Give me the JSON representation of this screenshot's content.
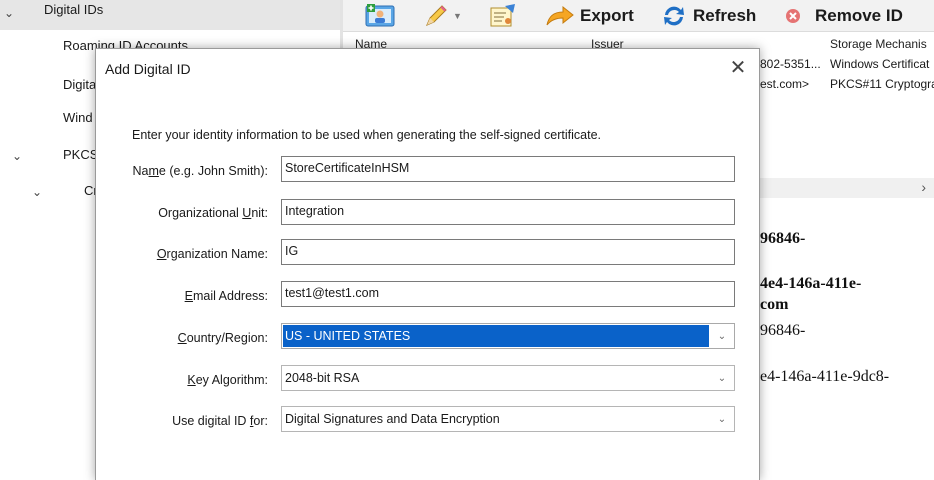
{
  "tree": {
    "items": [
      {
        "label": "Digital IDs",
        "chevron": "⌄"
      },
      {
        "label": "Roaming ID Accounts"
      },
      {
        "label": "Digita"
      },
      {
        "label": "Wind"
      },
      {
        "label": "PKCS",
        "chevron": "⌄"
      },
      {
        "label": "Cr",
        "chevron": "⌄"
      }
    ]
  },
  "toolbar": {
    "export_label": "Export",
    "refresh_label": "Refresh",
    "remove_label": "Remove ID"
  },
  "list": {
    "headers": [
      "Name",
      "Issuer",
      "Storage Mechanis"
    ],
    "rows": [
      [
        "802-5351...",
        "Windows Certificat"
      ],
      [
        "est.com>",
        "PKCS#11 Cryptogra"
      ]
    ]
  },
  "scroll_arrow": "›",
  "details": {
    "line1": "96846-",
    "line2": "4e4-146a-411e-",
    "line3": "com",
    "line4": "96846-",
    "line5": "e4-146a-411e-9dc8-"
  },
  "dialog": {
    "title": "Add Digital ID",
    "close_glyph": "✕",
    "intro": "Enter your identity information to be used when generating the self-signed certificate.",
    "name": {
      "label_pre": "Na",
      "label_u": "m",
      "label_post": "e (e.g. John Smith):",
      "value": "StoreCertificateInHSM"
    },
    "org_unit": {
      "label_pre": "Organizational ",
      "label_u": "U",
      "label_post": "nit:",
      "value": "Integration"
    },
    "org_name": {
      "label_pre": "",
      "label_u": "O",
      "label_post": "rganization Name:",
      "value": "IG"
    },
    "email": {
      "label_pre": "",
      "label_u": "E",
      "label_post": "mail Address:",
      "value": "test1@test1.com"
    },
    "country": {
      "label_pre": "",
      "label_u": "C",
      "label_post": "ountry/Region:",
      "value": "US - UNITED STATES"
    },
    "key_algorithm": {
      "label_pre": "",
      "label_u": "K",
      "label_post": "ey Algorithm:",
      "value": "2048-bit RSA"
    },
    "use_for": {
      "label_pre": "Use digital ID ",
      "label_u": "f",
      "label_post": "or:",
      "value": "Digital Signatures and Data Encryption"
    },
    "dropdown_glyph": "⌄"
  }
}
